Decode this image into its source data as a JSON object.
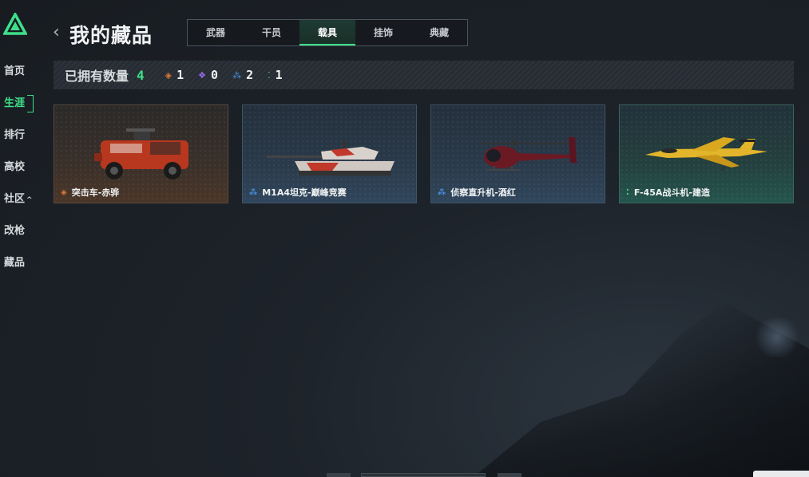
{
  "sidebar": {
    "items": [
      {
        "label": "首页",
        "active": false
      },
      {
        "label": "生涯",
        "active": true
      },
      {
        "label": "排行",
        "active": false
      },
      {
        "label": "高校",
        "active": false
      },
      {
        "label": "社区",
        "active": false,
        "caret": "^"
      },
      {
        "label": "改枪",
        "active": false
      },
      {
        "label": "藏品",
        "active": false
      }
    ]
  },
  "header": {
    "back_glyph": "‹",
    "title": "我的藏品",
    "tabs": [
      {
        "label": "武器",
        "active": false
      },
      {
        "label": "干员",
        "active": false
      },
      {
        "label": "载具",
        "active": true
      },
      {
        "label": "挂饰",
        "active": false
      },
      {
        "label": "典藏",
        "active": false
      }
    ]
  },
  "stats": {
    "label": "已拥有数量",
    "total": "4",
    "rarities": [
      {
        "icon": "diamond-orange-icon",
        "color": "#e07a3a",
        "count": "1"
      },
      {
        "icon": "diamond-purple-icon",
        "color": "#9b6bf0",
        "count": "0"
      },
      {
        "icon": "diamond-blue-icon",
        "color": "#4a8fe0",
        "count": "2"
      },
      {
        "icon": "diamond-green-icon",
        "color": "#3ee08a",
        "count": "1"
      }
    ]
  },
  "collection": [
    {
      "name": "突击车-赤骅",
      "rarity": "orange",
      "rarity_color": "#e07a3a",
      "icon": "assault-vehicle-icon"
    },
    {
      "name": "M1A4坦克-巅峰竞赛",
      "rarity": "blue",
      "rarity_color": "#4a8fe0",
      "icon": "tank-icon"
    },
    {
      "name": "侦察直升机-酒红",
      "rarity": "blue",
      "rarity_color": "#4a8fe0",
      "icon": "helicopter-icon"
    },
    {
      "name": "F-45A战斗机-建造",
      "rarity": "green",
      "rarity_color": "#3ee08a",
      "icon": "fighter-jet-icon"
    }
  ],
  "colors": {
    "accent": "#3ee08a",
    "background": "#1d232a"
  }
}
